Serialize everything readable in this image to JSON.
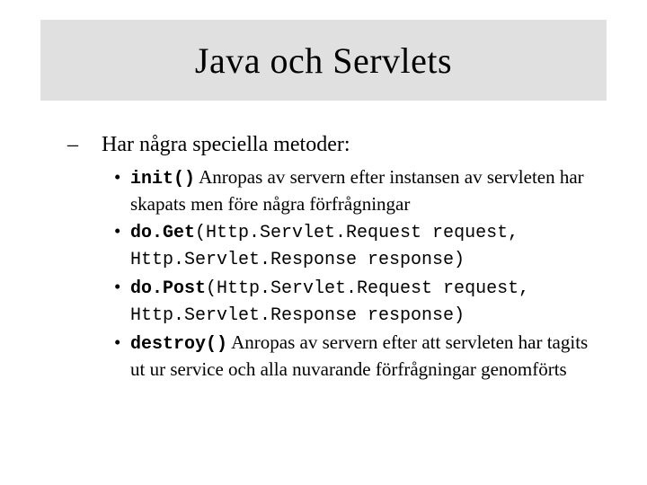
{
  "title": "Java och Servlets",
  "intro_dash": "–",
  "intro": "Har några speciella metoder:",
  "items": [
    {
      "code_bold": "init()",
      "code_rest": "",
      "desc": " Anropas av servern efter instansen av servleten har skapats men före några förfrågningar"
    },
    {
      "code_bold": "do.Get",
      "code_rest": "(Http.Servlet.Request request, Http.Servlet.Response response)",
      "desc": ""
    },
    {
      "code_bold": "do.Post",
      "code_rest": "(Http.Servlet.Request request, Http.Servlet.Response response)",
      "desc": ""
    },
    {
      "code_bold": "destroy()",
      "code_rest": "",
      "desc": " Anropas av servern efter att servleten har tagits ut ur service och alla nuvarande förfrågningar genomförts"
    }
  ]
}
